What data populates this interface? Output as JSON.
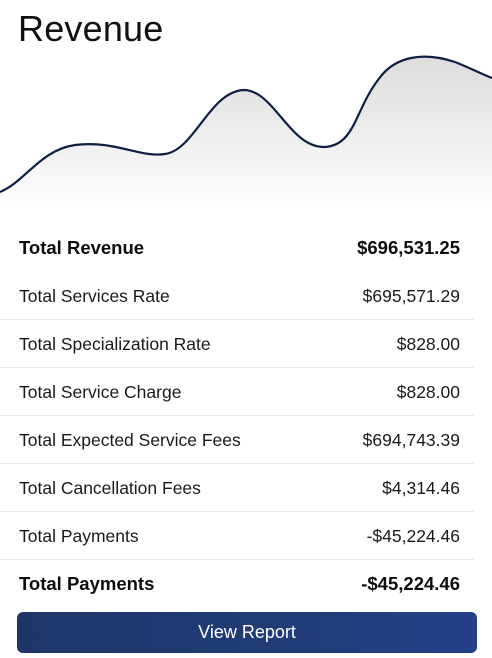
{
  "page": {
    "title": "Revenue"
  },
  "chart": {
    "type": "area",
    "line_color": "#0f1f44",
    "fill_color": "#e4e4e4"
  },
  "summary": {
    "rows": [
      {
        "label": "Total Revenue",
        "value": "$696,531.25"
      },
      {
        "label": "Total Services Rate",
        "value": "$695,571.29"
      },
      {
        "label": "Total Specialization Rate",
        "value": "$828.00"
      },
      {
        "label": "Total Service Charge",
        "value": "$828.00"
      },
      {
        "label": "Total Expected Service Fees",
        "value": "$694,743.39"
      },
      {
        "label": "Total Cancellation Fees",
        "value": "$4,314.46"
      },
      {
        "label": "Total Payments",
        "value": "-$45,224.46"
      },
      {
        "label": "Total Payments",
        "value": "-$45,224.46"
      }
    ]
  },
  "actions": {
    "view_report_label": "View Report"
  },
  "colors": {
    "button": "#213c77",
    "divider": "#e6e6e6"
  }
}
